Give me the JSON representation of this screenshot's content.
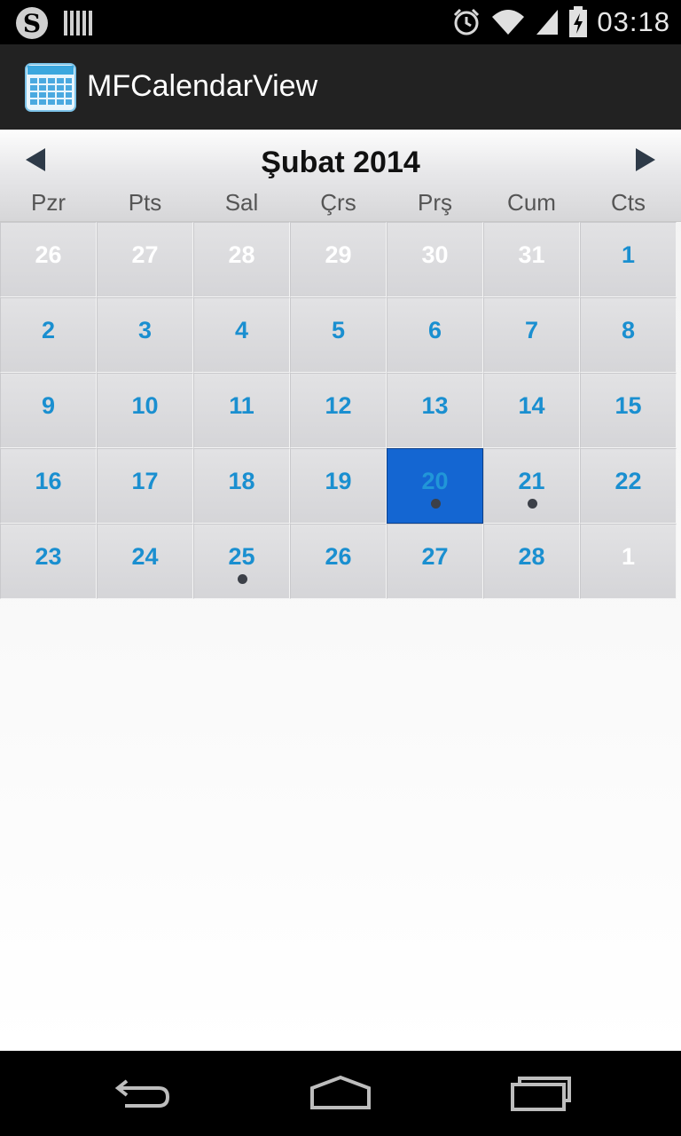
{
  "status_bar": {
    "time": "03:18",
    "left_icons": [
      "s-circle-icon",
      "barcode-notification-icon"
    ],
    "right_icons": [
      "alarm-clock-icon",
      "wifi-icon",
      "cell-signal-icon",
      "battery-charging-icon"
    ]
  },
  "action_bar": {
    "title": "MFCalendarView",
    "icon": "calendar-app-icon"
  },
  "calendar": {
    "month_title": "Şubat 2014",
    "prev_icon": "left-arrow-icon",
    "next_icon": "right-arrow-icon",
    "weekdays": [
      "Pzr",
      "Pts",
      "Sal",
      "Çrs",
      "Prş",
      "Cum",
      "Cts"
    ],
    "weeks": [
      [
        {
          "day": "26",
          "other_month": true,
          "event": false,
          "selected": false
        },
        {
          "day": "27",
          "other_month": true,
          "event": false,
          "selected": false
        },
        {
          "day": "28",
          "other_month": true,
          "event": false,
          "selected": false
        },
        {
          "day": "29",
          "other_month": true,
          "event": false,
          "selected": false
        },
        {
          "day": "30",
          "other_month": true,
          "event": false,
          "selected": false
        },
        {
          "day": "31",
          "other_month": true,
          "event": false,
          "selected": false
        },
        {
          "day": "1",
          "other_month": false,
          "event": false,
          "selected": false
        }
      ],
      [
        {
          "day": "2",
          "other_month": false,
          "event": false,
          "selected": false
        },
        {
          "day": "3",
          "other_month": false,
          "event": false,
          "selected": false
        },
        {
          "day": "4",
          "other_month": false,
          "event": false,
          "selected": false
        },
        {
          "day": "5",
          "other_month": false,
          "event": false,
          "selected": false
        },
        {
          "day": "6",
          "other_month": false,
          "event": false,
          "selected": false
        },
        {
          "day": "7",
          "other_month": false,
          "event": false,
          "selected": false
        },
        {
          "day": "8",
          "other_month": false,
          "event": false,
          "selected": false
        }
      ],
      [
        {
          "day": "9",
          "other_month": false,
          "event": false,
          "selected": false
        },
        {
          "day": "10",
          "other_month": false,
          "event": false,
          "selected": false
        },
        {
          "day": "11",
          "other_month": false,
          "event": false,
          "selected": false
        },
        {
          "day": "12",
          "other_month": false,
          "event": false,
          "selected": false
        },
        {
          "day": "13",
          "other_month": false,
          "event": false,
          "selected": false
        },
        {
          "day": "14",
          "other_month": false,
          "event": false,
          "selected": false
        },
        {
          "day": "15",
          "other_month": false,
          "event": false,
          "selected": false
        }
      ],
      [
        {
          "day": "16",
          "other_month": false,
          "event": false,
          "selected": false
        },
        {
          "day": "17",
          "other_month": false,
          "event": false,
          "selected": false
        },
        {
          "day": "18",
          "other_month": false,
          "event": false,
          "selected": false
        },
        {
          "day": "19",
          "other_month": false,
          "event": false,
          "selected": false
        },
        {
          "day": "20",
          "other_month": false,
          "event": true,
          "selected": true
        },
        {
          "day": "21",
          "other_month": false,
          "event": true,
          "selected": false
        },
        {
          "day": "22",
          "other_month": false,
          "event": false,
          "selected": false
        }
      ],
      [
        {
          "day": "23",
          "other_month": false,
          "event": false,
          "selected": false
        },
        {
          "day": "24",
          "other_month": false,
          "event": false,
          "selected": false
        },
        {
          "day": "25",
          "other_month": false,
          "event": true,
          "selected": false
        },
        {
          "day": "26",
          "other_month": false,
          "event": false,
          "selected": false
        },
        {
          "day": "27",
          "other_month": false,
          "event": false,
          "selected": false
        },
        {
          "day": "28",
          "other_month": false,
          "event": false,
          "selected": false
        },
        {
          "day": "1",
          "other_month": true,
          "event": false,
          "selected": false
        }
      ]
    ]
  },
  "nav_bar": {
    "buttons": [
      "back-icon",
      "home-icon",
      "recent-apps-icon"
    ]
  },
  "colors": {
    "day_number": "#1a8fd0",
    "other_month_day": "#ffffff",
    "selected_cell": "#1466d2",
    "event_dot": "#3c4048",
    "action_bar": "#222222"
  }
}
